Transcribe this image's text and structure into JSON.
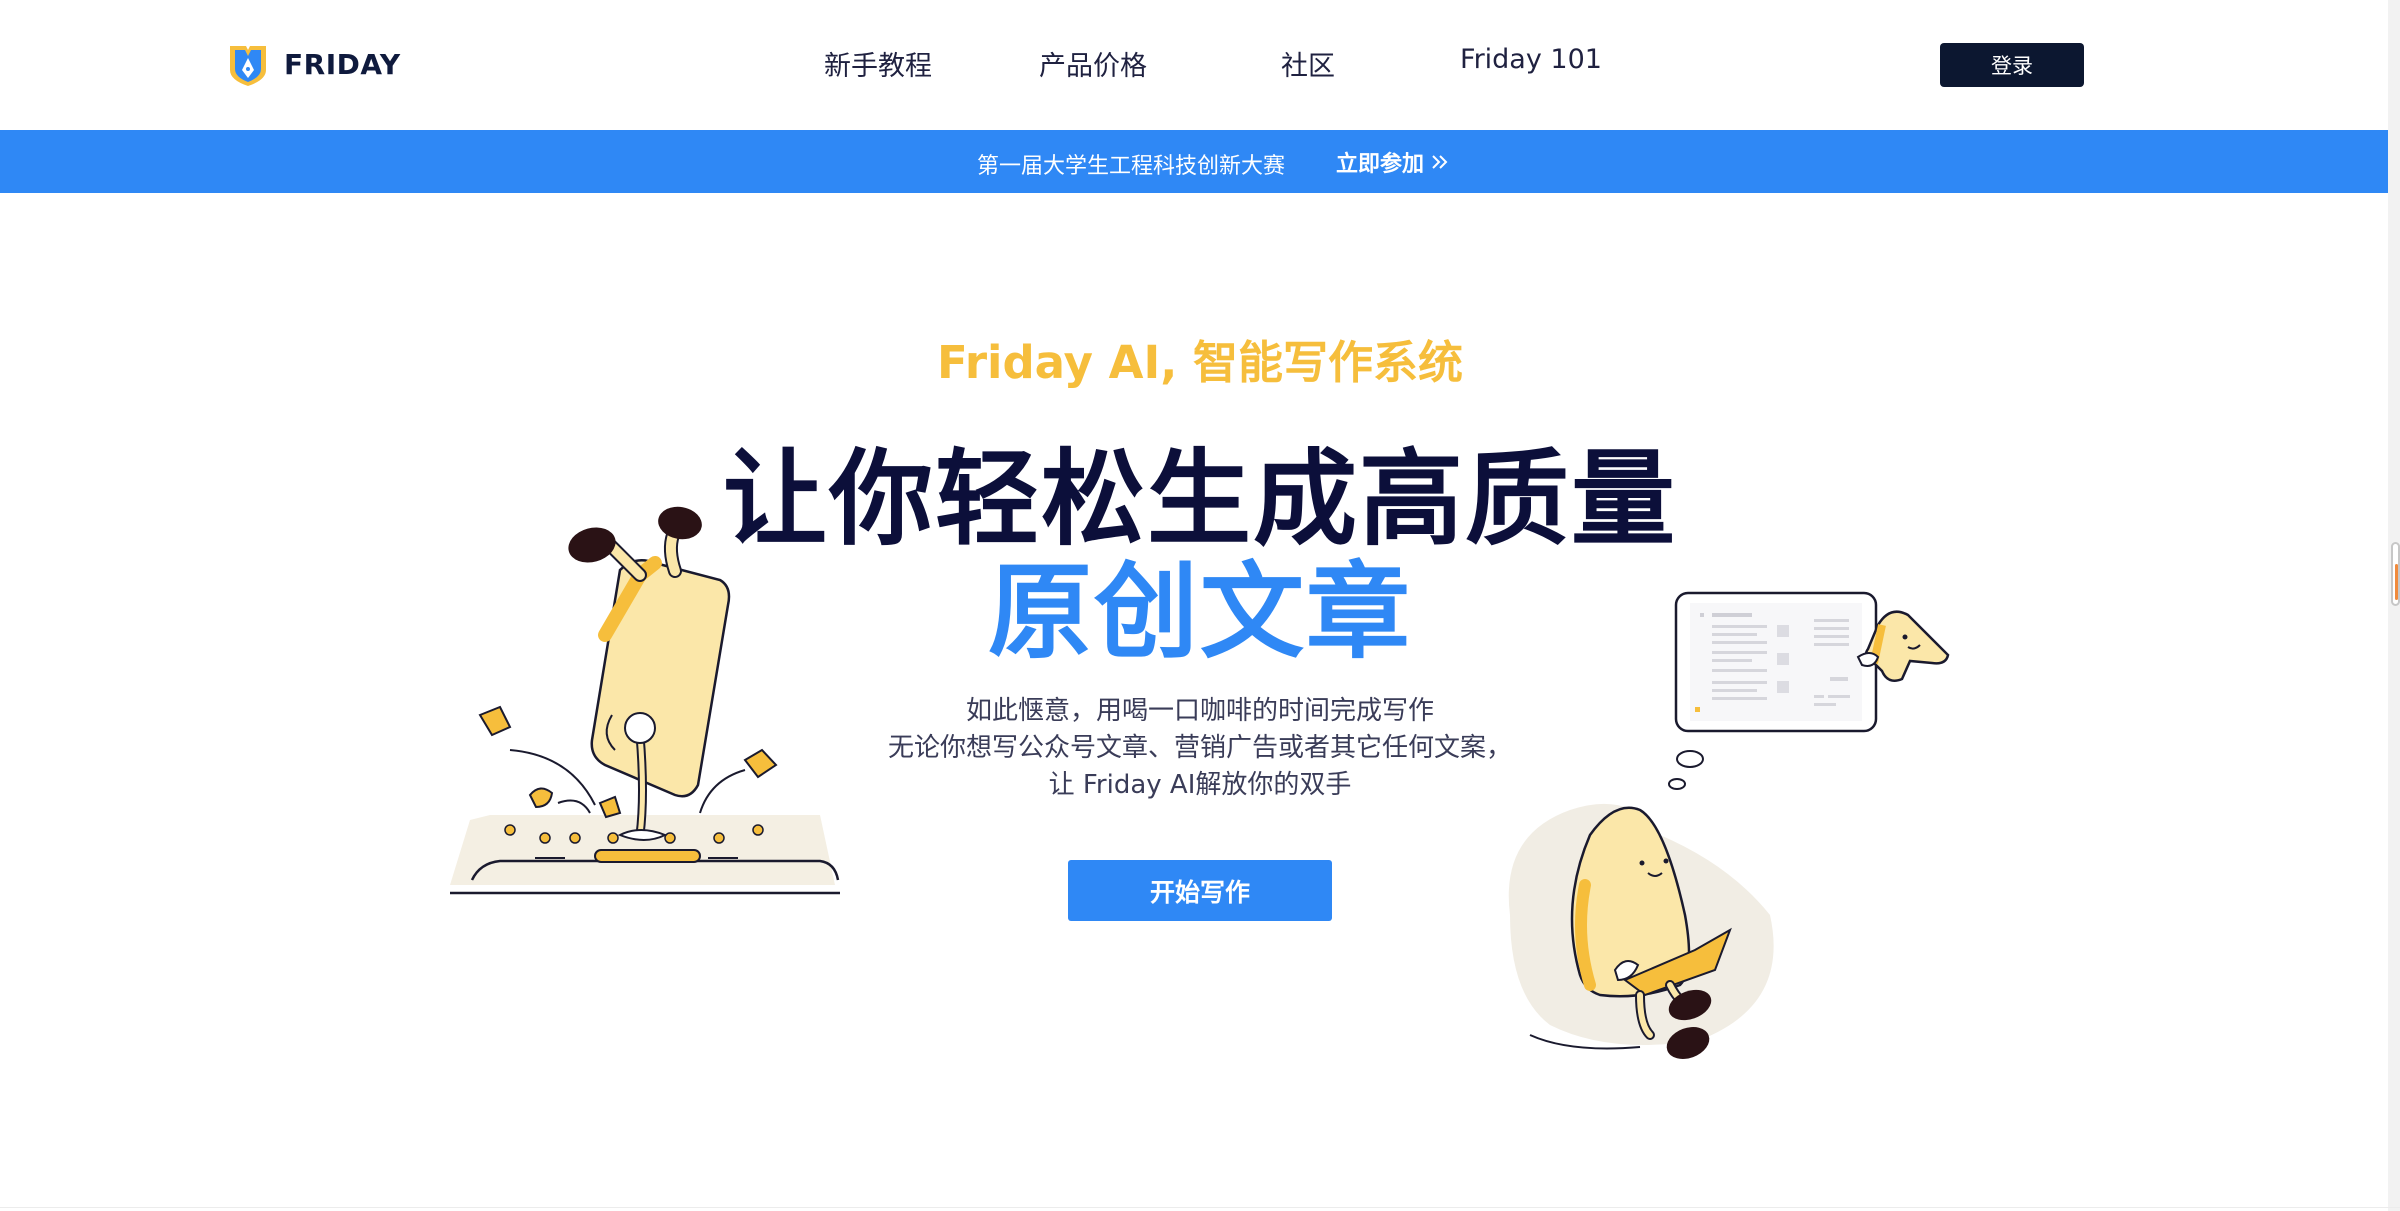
{
  "header": {
    "logo_text": "FRIDAY",
    "nav": [
      {
        "label": "新手教程"
      },
      {
        "label": "产品价格"
      },
      {
        "label": "社区"
      },
      {
        "label": "Friday 101"
      }
    ],
    "login_label": "登录"
  },
  "banner": {
    "text": "第一届大学生工程科技创新大赛",
    "cta": "立即参加"
  },
  "hero": {
    "subtitle": "Friday AI, 智能写作系统",
    "headline_line1": "让你轻松生成高质量",
    "headline_line2": "原创文章",
    "desc_line1": "如此惬意，用喝一口咖啡的时间完成写作",
    "desc_line2": "无论你想写公众号文章、营销广告或者其它任何文案，",
    "desc_line3": "让 Friday AI解放你的双手",
    "start_label": "开始写作"
  },
  "colors": {
    "brand_blue": "#2f88f5",
    "accent_yellow": "#f6be3c",
    "dark_navy": "#0c0f3a"
  },
  "icons": [
    "friday-logo-icon",
    "double-chevron-right-icon",
    "scrollbar-thumb"
  ]
}
